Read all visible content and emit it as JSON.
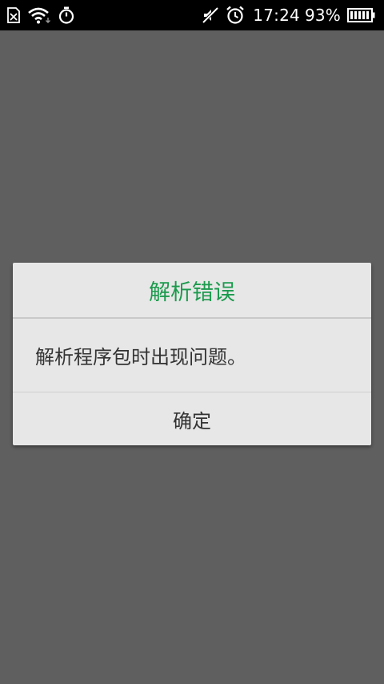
{
  "status_bar": {
    "left_icons": [
      "sim-card-error-icon",
      "wifi-icon",
      "stopwatch-icon"
    ],
    "right_icons": [
      "silent-mode-icon",
      "alarm-icon"
    ],
    "time": "17:24",
    "battery_percent": "93%",
    "battery_level": 0.93
  },
  "dialog": {
    "title": "解析错误",
    "message": "解析程序包时出现问题。",
    "confirm_label": "确定",
    "title_color": "#1c9a4d"
  }
}
